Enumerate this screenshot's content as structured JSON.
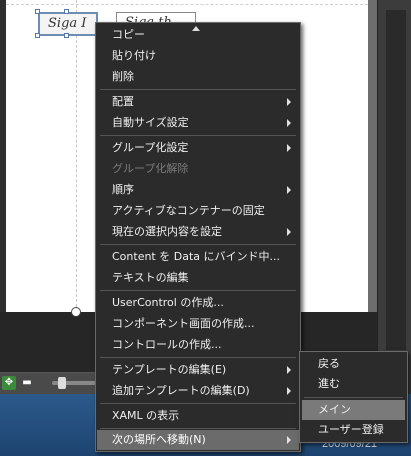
{
  "canvas": {
    "buttons": [
      {
        "label": "Siga I"
      },
      {
        "label": "Siga th"
      }
    ]
  },
  "context_menu": {
    "items": [
      {
        "label": "コピー"
      },
      {
        "label": "貼り付け"
      },
      {
        "label": "削除"
      },
      {
        "label": "配置"
      },
      {
        "label": "自動サイズ設定"
      },
      {
        "label": "グループ化設定"
      },
      {
        "label": "グループ化解除"
      },
      {
        "label": "順序"
      },
      {
        "label": "アクティブなコンテナーの固定"
      },
      {
        "label": "現在の選択内容を設定"
      },
      {
        "label": "Content を Data にバインド中..."
      },
      {
        "label": "テキストの編集"
      },
      {
        "label": "UserControl の作成..."
      },
      {
        "label": "コンポーネント画面の作成..."
      },
      {
        "label": "コントロールの作成..."
      },
      {
        "label": "テンプレートの編集(E)"
      },
      {
        "label": "追加テンプレートの編集(D)"
      },
      {
        "label": "XAML の表示"
      },
      {
        "label": "次の場所へ移動(N)"
      }
    ]
  },
  "submenu": {
    "items": [
      {
        "label": "戻る"
      },
      {
        "label": "進む"
      },
      {
        "label": "メイン"
      },
      {
        "label": "ユーザー登録"
      }
    ]
  },
  "taskbar": {
    "date": "2009/09/21"
  },
  "colors": {
    "menu_bg": "#2b2b2b",
    "menu_highlight": "#6b6b6b",
    "taskbar": "#2c5a8c"
  }
}
